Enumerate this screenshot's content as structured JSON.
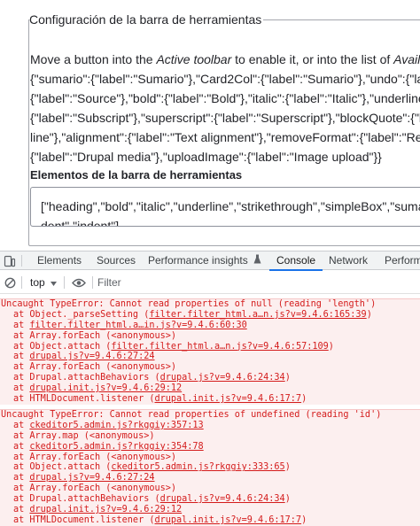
{
  "page": {
    "legend": "Configuración de la barra de herramientas",
    "description_lines": [
      [
        "Move a button into the ",
        "Active toolbar",
        " to enable it, or into the list of ",
        "Availa"
      ],
      [
        "{\"sumario\":{\"label\":\"Sumario\"},\"Card2Col\":{\"label\":\"Sumario\"},\"undo\":{\"lab"
      ],
      [
        "{\"label\":\"Source\"},\"bold\":{\"label\":\"Bold\"},\"italic\":{\"label\":\"Italic\"},\"underline"
      ],
      [
        "{\"label\":\"Subscript\"},\"superscript\":{\"label\":\"Superscript\"},\"blockQuote\":{\"l"
      ],
      [
        "line\"},\"alignment\":{\"label\":\"Text alignment\"},\"removeFormat\":{\"label\":\"Rem"
      ],
      [
        "{\"label\":\"Drupal media\"},\"uploadImage\":{\"label\":\"Image upload\"}}"
      ]
    ],
    "field_label": "Elementos de la barra de herramientas",
    "textarea_line1": "[\"heading\",\"bold\",\"italic\",\"underline\",\"strikethrough\",\"simpleBox\",\"sumari",
    "textarea_line2": "dent\",\"indent\"]"
  },
  "devtools": {
    "tabs": [
      "Elements",
      "Sources",
      "Performance insights",
      "Console",
      "Network",
      "Perform"
    ],
    "active_tab": "Console",
    "context": "top",
    "filter_placeholder": "Filter",
    "accent_color": "#1a73e8",
    "error_color": "#d41c1c",
    "errors": [
      {
        "message": "Uncaught TypeError: Cannot read properties of null (reading 'length')",
        "frames": [
          {
            "prefix": "at Object._parseSetting (",
            "link": "filter.filter_html.a…n.js?v=9.4.6:165:39",
            "suffix": ")"
          },
          {
            "prefix": "at ",
            "link": "filter.filter_html.a…in.js?v=9.4.6:60:30",
            "suffix": ""
          },
          {
            "prefix": "at Array.forEach (<anonymous>)",
            "link": "",
            "suffix": ""
          },
          {
            "prefix": "at Object.attach (",
            "link": "filter.filter_html.a…n.js?v=9.4.6:57:109",
            "suffix": ")"
          },
          {
            "prefix": "at ",
            "link": "drupal.js?v=9.4.6:27:24",
            "suffix": ""
          },
          {
            "prefix": "at Array.forEach (<anonymous>)",
            "link": "",
            "suffix": ""
          },
          {
            "prefix": "at Drupal.attachBehaviors (",
            "link": "drupal.js?v=9.4.6:24:34",
            "suffix": ")"
          },
          {
            "prefix": "at ",
            "link": "drupal.init.js?v=9.4.6:29:12",
            "suffix": ""
          },
          {
            "prefix": "at HTMLDocument.listener (",
            "link": "drupal.init.js?v=9.4.6:17:7",
            "suffix": ")"
          }
        ]
      },
      {
        "message": "Uncaught TypeError: Cannot read properties of undefined (reading 'id')",
        "frames": [
          {
            "prefix": "at ",
            "link": "ckeditor5.admin.js?rkggiy:357:13",
            "suffix": ""
          },
          {
            "prefix": "at Array.map (<anonymous>)",
            "link": "",
            "suffix": ""
          },
          {
            "prefix": "at ",
            "link": "ckeditor5.admin.js?rkggiy:354:78",
            "suffix": ""
          },
          {
            "prefix": "at Array.forEach (<anonymous>)",
            "link": "",
            "suffix": ""
          },
          {
            "prefix": "at Object.attach (",
            "link": "ckeditor5.admin.js?rkggiy:333:65",
            "suffix": ")"
          },
          {
            "prefix": "at ",
            "link": "drupal.js?v=9.4.6:27:24",
            "suffix": ""
          },
          {
            "prefix": "at Array.forEach (<anonymous>)",
            "link": "",
            "suffix": ""
          },
          {
            "prefix": "at Drupal.attachBehaviors (",
            "link": "drupal.js?v=9.4.6:24:34",
            "suffix": ")"
          },
          {
            "prefix": "at ",
            "link": "drupal.init.js?v=9.4.6:29:12",
            "suffix": ""
          },
          {
            "prefix": "at HTMLDocument.listener (",
            "link": "drupal.init.js?v=9.4.6:17:7",
            "suffix": ")"
          }
        ]
      }
    ]
  }
}
